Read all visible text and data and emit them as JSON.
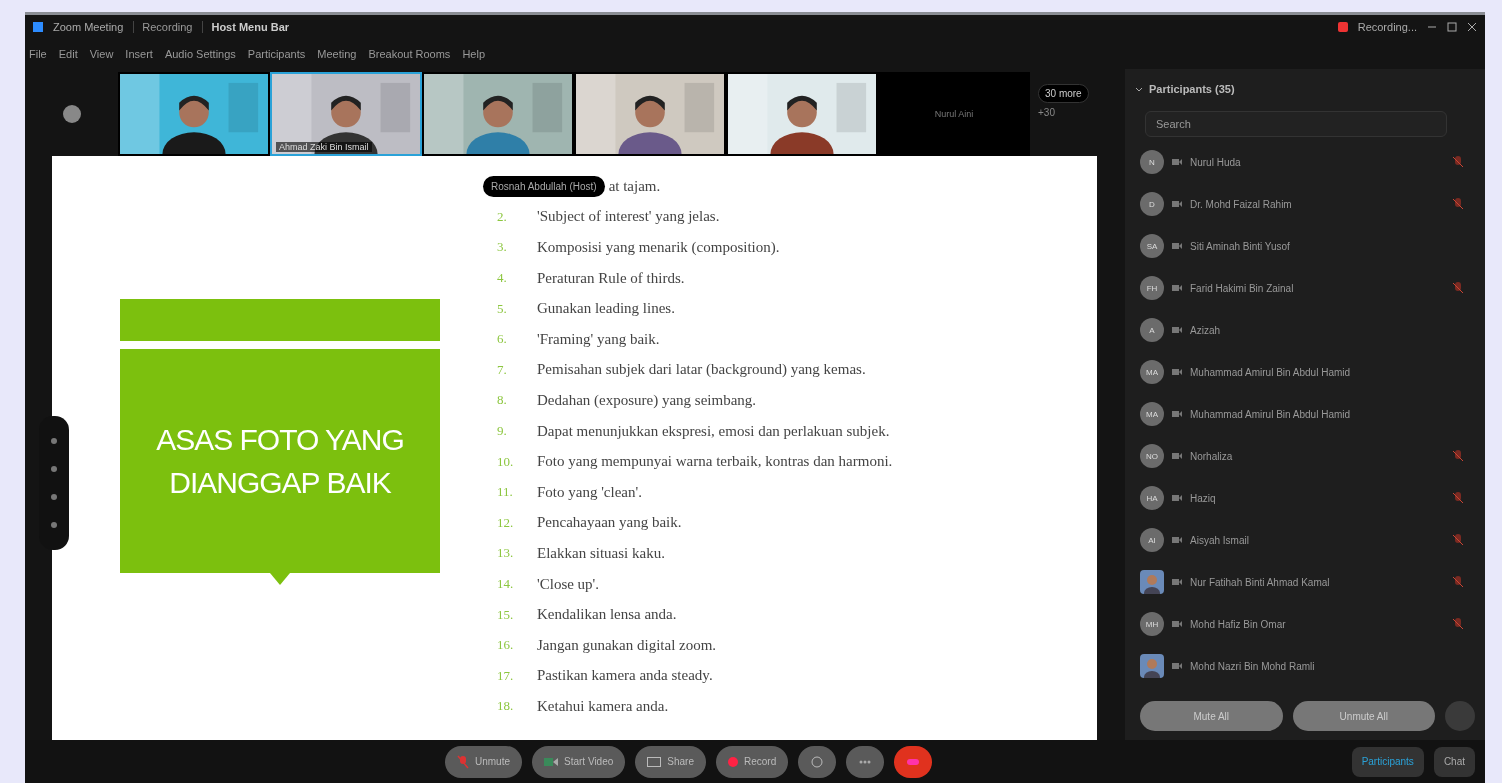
{
  "window": {
    "title": "Zoom Meeting",
    "tabs": [
      {
        "label": "Recording",
        "selected": false
      },
      {
        "label": "Host Menu Bar",
        "selected": true
      }
    ],
    "recording": "Recording..."
  },
  "menu": [
    "File",
    "Edit",
    "View",
    "Insert",
    "Audio Settings",
    "Participants",
    "Meeting",
    "Breakout Rooms",
    "Help"
  ],
  "videos": [
    {
      "kind": "picture",
      "speaking": false
    },
    {
      "kind": "picture",
      "speaking": true,
      "name": "Ahmad Zaki Bin Ismail"
    },
    {
      "kind": "picture",
      "speaking": false
    },
    {
      "kind": "picture",
      "speaking": false
    },
    {
      "kind": "picture",
      "speaking": false
    },
    {
      "kind": "off",
      "speaking": false,
      "name": "Nurul Aini"
    }
  ],
  "more_videos": "30 more",
  "more_count": "+30",
  "slide": {
    "title": "ASAS FOTO YANG DIANGGAP BAIK",
    "speaker_label": "Rosnah Abdullah (Host)",
    "items": [
      {
        "text": "at tajam."
      },
      {
        "number": "2.",
        "text": "'Subject of interest' yang jelas."
      },
      {
        "number": "3.",
        "text": "Komposisi yang menarik (composition)."
      },
      {
        "number": "4.",
        "text": "Peraturan Rule of thirds."
      },
      {
        "number": "5.",
        "text": "Gunakan leading lines."
      },
      {
        "number": "6.",
        "text": "'Framing' yang baik."
      },
      {
        "number": "7.",
        "text": "Pemisahan subjek dari latar (background) yang kemas."
      },
      {
        "number": "8.",
        "text": "Dedahan (exposure) yang seimbang."
      },
      {
        "number": "9.",
        "text": "Dapat menunjukkan ekspresi, emosi dan perlakuan subjek."
      },
      {
        "number": "10.",
        "text": "Foto yang mempunyai warna terbaik, kontras dan harmoni."
      },
      {
        "number": "11.",
        "text": "Foto yang 'clean'."
      },
      {
        "number": "12.",
        "text": "Pencahayaan yang baik."
      },
      {
        "number": "13.",
        "text": "Elakkan situasi kaku."
      },
      {
        "number": "14.",
        "text": "'Close up'."
      },
      {
        "number": "15.",
        "text": "Kendalikan lensa anda."
      },
      {
        "number": "16.",
        "text": "Jangan gunakan digital zoom."
      },
      {
        "number": "17.",
        "text": "Pastikan kamera anda steady."
      },
      {
        "number": "18.",
        "text": "Ketahui kamera anda."
      }
    ]
  },
  "participants": {
    "title": "Participants (35)",
    "search": {
      "placeholder": "Search"
    },
    "rows": [
      {
        "kind": "initials",
        "initials": "N",
        "name": "Nurul Huda",
        "muted": true
      },
      {
        "kind": "initials",
        "initials": "D",
        "name": "Dr. Mohd Faizal Rahim",
        "muted": true
      },
      {
        "kind": "initials",
        "initials": "SA",
        "name": "Siti Aminah Binti Yusof",
        "muted": false
      },
      {
        "kind": "initials",
        "initials": "FH",
        "name": "Farid Hakimi Bin Zainal",
        "muted": true
      },
      {
        "kind": "initials",
        "initials": "A",
        "name": "Azizah",
        "muted": false
      },
      {
        "kind": "initials",
        "initials": "MA",
        "name": "Muhammad Amirul Bin Abdul Hamid",
        "muted": false
      },
      {
        "kind": "initials",
        "initials": "MA",
        "name": "Muhammad Amirul Bin Abdul Hamid",
        "muted": false
      },
      {
        "kind": "initials",
        "initials": "NO",
        "name": "Norhaliza",
        "muted": true
      },
      {
        "kind": "initials",
        "initials": "HA",
        "name": "Haziq",
        "muted": true
      },
      {
        "kind": "initials",
        "initials": "AI",
        "name": "Aisyah Ismail",
        "muted": true
      },
      {
        "name": "Nur Fatihah Binti Ahmad Kamal",
        "muted": true
      },
      {
        "kind": "initials",
        "initials": "MH",
        "name": "Mohd Hafiz Bin Omar",
        "muted": true
      },
      {
        "name": "Mohd Nazri Bin Mohd Ramli",
        "muted": false
      }
    ],
    "buttons": [
      "Mute All",
      "Unmute All"
    ]
  },
  "toolbar": [
    {
      "kind": "mic",
      "label": "Unmute"
    },
    {
      "kind": "video",
      "label": "Start Video"
    },
    {
      "kind": "share",
      "label": "Share"
    },
    {
      "kind": "record",
      "label": "Record"
    },
    {
      "kind": "reactions"
    },
    {
      "kind": "more"
    },
    {
      "kind": "end"
    }
  ],
  "panel_tabs": [
    {
      "label": "Participants",
      "selected": true
    },
    {
      "label": "Chat",
      "selected": false
    }
  ]
}
